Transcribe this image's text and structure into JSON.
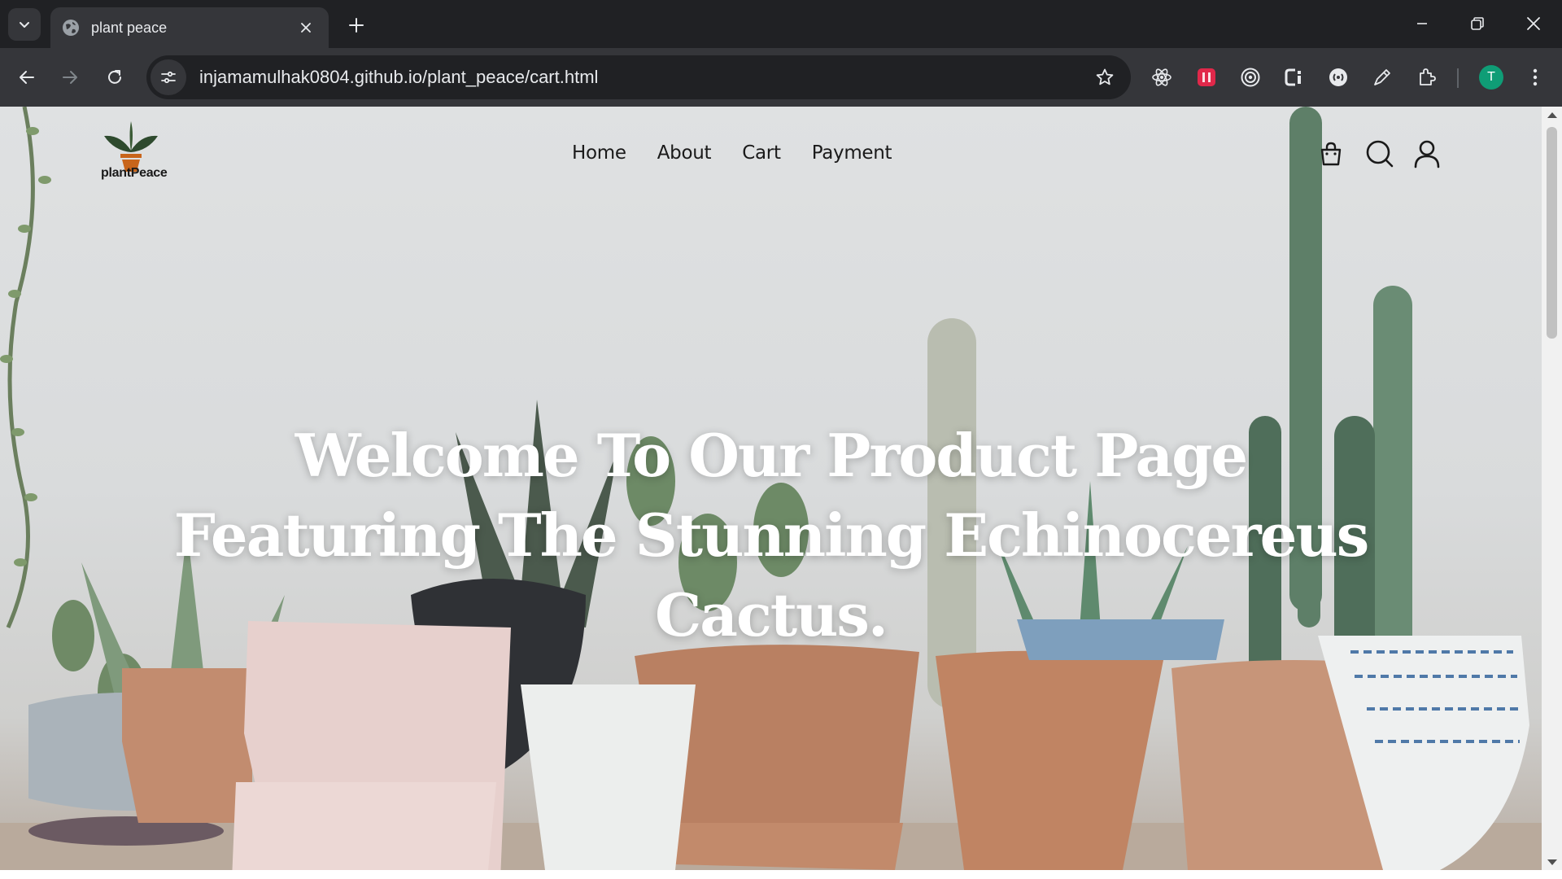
{
  "browser": {
    "tab": {
      "title": "plant peace"
    },
    "address": {
      "url": "injamamulhak0804.github.io/plant_peace/cart.html"
    },
    "profile": {
      "initial": "T"
    },
    "extensions": [
      "react-devtools-icon",
      "red-extension-icon",
      "target-icon",
      "ci-extension-icon",
      "circle-extension-icon",
      "pen-icon",
      "puzzle-icon"
    ],
    "colors": {
      "frame": "#202124",
      "toolbar": "#35363a",
      "text": "#e8eaed",
      "avatar": "#0f9d76"
    }
  },
  "site": {
    "logo_text": "plantPeace",
    "nav": [
      {
        "label": "Home"
      },
      {
        "label": "About"
      },
      {
        "label": "Cart"
      },
      {
        "label": "Payment"
      }
    ],
    "header_icons": [
      "shopping-bag-icon",
      "search-icon",
      "user-icon"
    ],
    "hero": {
      "lines": [
        "Welcome To Our Product Page",
        "Featuring The Stunning Echinocereus",
        "Cactus."
      ]
    }
  }
}
